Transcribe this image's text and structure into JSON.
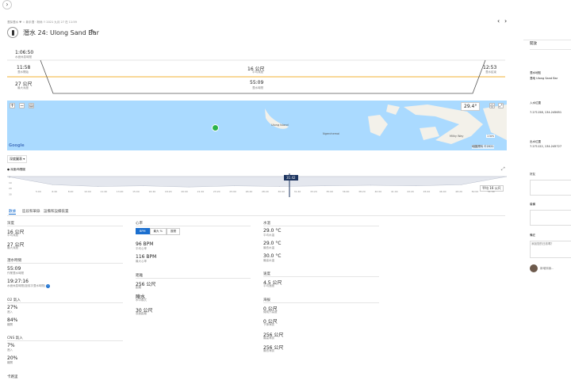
{
  "header": {
    "back_arrow": "›",
    "meta": "潛探潛水 ♥  ☆ 新手潛 · 粉絲  ⏱ 2021 九月 27 在 11:59",
    "title": "潛水 24: Ulong Sand Bar",
    "edit_icon": "pencil-icon",
    "nav_prev": "‹",
    "nav_next": "›"
  },
  "profile": {
    "total_time": "1:06:50",
    "total_time_label": "水面休息時間",
    "entry_time": "11:58",
    "entry_label": "潛水開始",
    "max_depth_center": "16 公尺",
    "max_depth_center_label": "平均深度",
    "exit_time": "12:53",
    "exit_label": "潛水結束",
    "max_depth_left": "27 公尺",
    "max_depth_left_label": "最大深度",
    "bottom_time": "55:09",
    "bottom_time_label": "潛水時間"
  },
  "map": {
    "zoom_in": "+",
    "zoom_out": "−",
    "layers": "layers-icon",
    "temp": "29.4°",
    "compass": "compass-icon",
    "fullscreen": "fullscreen-icon",
    "label_island": "Ulong Island",
    "label_ngerchemai": "Ngerchemai",
    "label_milky": "Milky Way",
    "google": "Google",
    "attribution": "地圖資料 ©2021",
    "scale": "1 km"
  },
  "chart": {
    "dropdown": "深度圖表 ▾",
    "section_title": "● 深度/時間圖",
    "badge": "31:42",
    "avg_label": "平均 16 公尺",
    "time_ticks": [
      "5:00",
      "6:40",
      "8:20",
      "10:00",
      "11:40",
      "13:20",
      "15:00",
      "16:40",
      "18:20",
      "20:00",
      "21:40",
      "23:20",
      "25:00",
      "26:40",
      "28:20",
      "30:00",
      "31:40",
      "33:20",
      "35:00",
      "36:40",
      "38:20",
      "40:00",
      "41:40",
      "43:20",
      "45:00",
      "46:40",
      "48:20",
      "50:00",
      "51:40"
    ],
    "depth_ticks": [
      "0",
      "10",
      "20",
      "30"
    ],
    "chart_data": {
      "type": "area",
      "title": "",
      "x": [
        "0:00",
        "5:00",
        "10:00",
        "15:00",
        "20:00",
        "25:00",
        "30:00",
        "35:00",
        "40:00",
        "45:00",
        "50:00",
        "55:09"
      ],
      "series": [
        {
          "values": [
            0,
            14,
            17,
            16,
            18,
            16,
            17,
            16,
            15,
            16,
            14,
            0
          ]
        }
      ],
      "ylim": [
        0,
        30
      ]
    }
  },
  "tabs": [
    "數據",
    "區段和筆錄",
    "設備和設備裝置"
  ],
  "col1": {
    "depth_title": "深度",
    "avg_depth": "16 公尺",
    "avg_depth_label": "平均深度",
    "max_depth": "27 公尺",
    "max_depth_label": "最大深度",
    "time_title": "潛水時間",
    "dive_time": "55:09",
    "dive_time_label": "作業潛水時間",
    "surface_time": "19:27:16",
    "surface_time_label": "水面休息時間(距前次潛水時間) ",
    "o2_title": "O2 氣入",
    "o2_pct": "27%",
    "o2_pct_label": "進入",
    "o2_pct2": "84%",
    "o2_pct2_label": "離開",
    "cns_title": "CNS 氣入",
    "cns_pct": "7%",
    "cns_pct_label": "進入",
    "cns_pct2": "20%",
    "cns_pct2_label": "離開",
    "bottom_title": "卡路里"
  },
  "col2": {
    "hr_title": "心率",
    "toggles": [
      "BPM",
      "最大 %",
      "區間"
    ],
    "avg_hr": "96 BPM",
    "avg_hr_label": "平均心率",
    "max_hr": "116 BPM",
    "max_hr_label": "最大心率",
    "dist_title": "距離",
    "dist": "256 公尺",
    "dist_label": "距離",
    "type_val": "陣水",
    "type_label": "水中模式",
    "surface_val": "30 公尺",
    "surface_label": "表面距離"
  },
  "col3": {
    "temp_title": "水溫",
    "avg_temp": "29.0 °C",
    "avg_temp_label": "平均水溫",
    "min_temp": "29.0 °C",
    "min_temp_label": "最低水溫",
    "max_temp": "30.0 °C",
    "max_temp_label": "最高水溫",
    "speed_title": "速度",
    "speed": "4.5 公尺",
    "speed_label": "平均速度",
    "elev_title": "海拔",
    "elev1": "0 公尺",
    "elev1_label": "總爬升高度",
    "elev2": "0 公尺",
    "elev2_label": "下降海拔",
    "elev3": "256 公尺",
    "elev3_label": "最高海拔",
    "elev4": "256 公尺",
    "elev4_label": "最低海拔"
  },
  "sidebar": {
    "heading": "開放",
    "location_title": "潛水地點",
    "location_val": "潛地 Ulong Sand Bar",
    "entry_title": "入水位置",
    "entry_val": "7.271158, 134.245651",
    "exit_title": "出水位置",
    "exit_val": "7.271122, 134.245727",
    "buddy_title": "好友",
    "gear_title": "裝備",
    "notes_title": "備註",
    "notes_placeholder": "添加您的日誌嗎？",
    "comment_placeholder": "新增評論..."
  }
}
